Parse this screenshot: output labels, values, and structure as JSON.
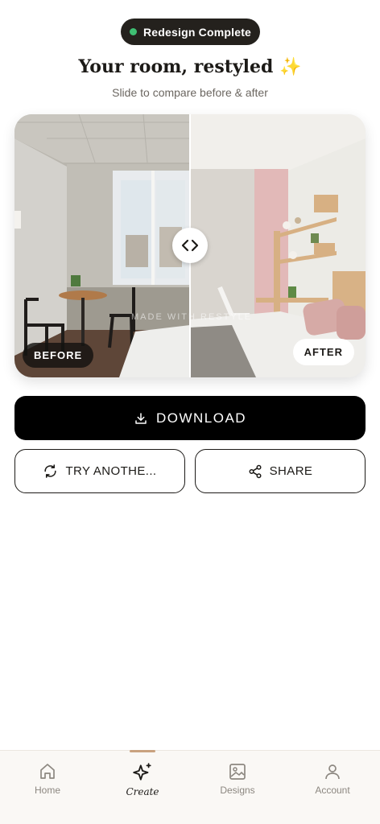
{
  "status": {
    "label": "Redesign Complete",
    "dot_color": "#3fbf73"
  },
  "header": {
    "title": "Your room, restyled",
    "title_emoji": "✨",
    "subtitle": "Slide to compare before & after"
  },
  "compare": {
    "before_label": "BEFORE",
    "after_label": "AFTER",
    "watermark": "MADE WITH RESTYLE",
    "slider_position": 0.5,
    "handle_icon": "chevrons-left-right-icon"
  },
  "actions": {
    "download": {
      "label": "DOWNLOAD",
      "icon": "download-icon"
    },
    "try_another": {
      "label": "TRY ANOTHE...",
      "icon": "refresh-icon"
    },
    "share": {
      "label": "SHARE",
      "icon": "share-icon"
    }
  },
  "nav": {
    "items": [
      {
        "label": "Home",
        "icon": "home-icon"
      },
      {
        "label": "Create",
        "icon": "sparkle-icon",
        "active": true
      },
      {
        "label": "Designs",
        "icon": "image-icon"
      },
      {
        "label": "Account",
        "icon": "user-icon"
      }
    ],
    "accent": "#c9a27f"
  }
}
